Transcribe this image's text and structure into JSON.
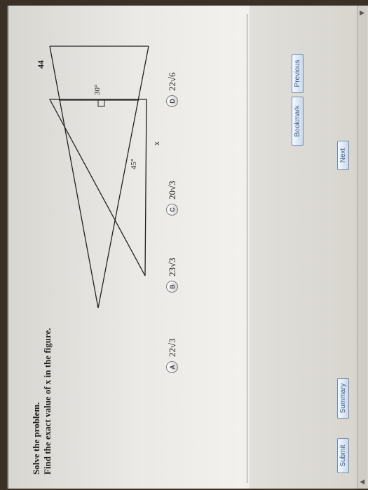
{
  "question": {
    "instruction": "Solve the problem.",
    "prompt": "Find the exact value of x in the figure."
  },
  "figure": {
    "side_label": "44",
    "angle_top": "30°",
    "angle_right": "45°",
    "unknown_label": "x"
  },
  "choices": [
    {
      "letter": "A",
      "text": "22√3"
    },
    {
      "letter": "B",
      "text": "23√3"
    },
    {
      "letter": "C",
      "text": "20√3"
    },
    {
      "letter": "D",
      "text": "22√6"
    }
  ],
  "buttons": {
    "previous": "Previous",
    "bookmark": "Bookmark",
    "next": "Next",
    "summary": "Summary",
    "submit": "Submit"
  },
  "scrollbar": {
    "up_icon": "chevron-up-icon",
    "down_icon": "chevron-down-icon"
  }
}
